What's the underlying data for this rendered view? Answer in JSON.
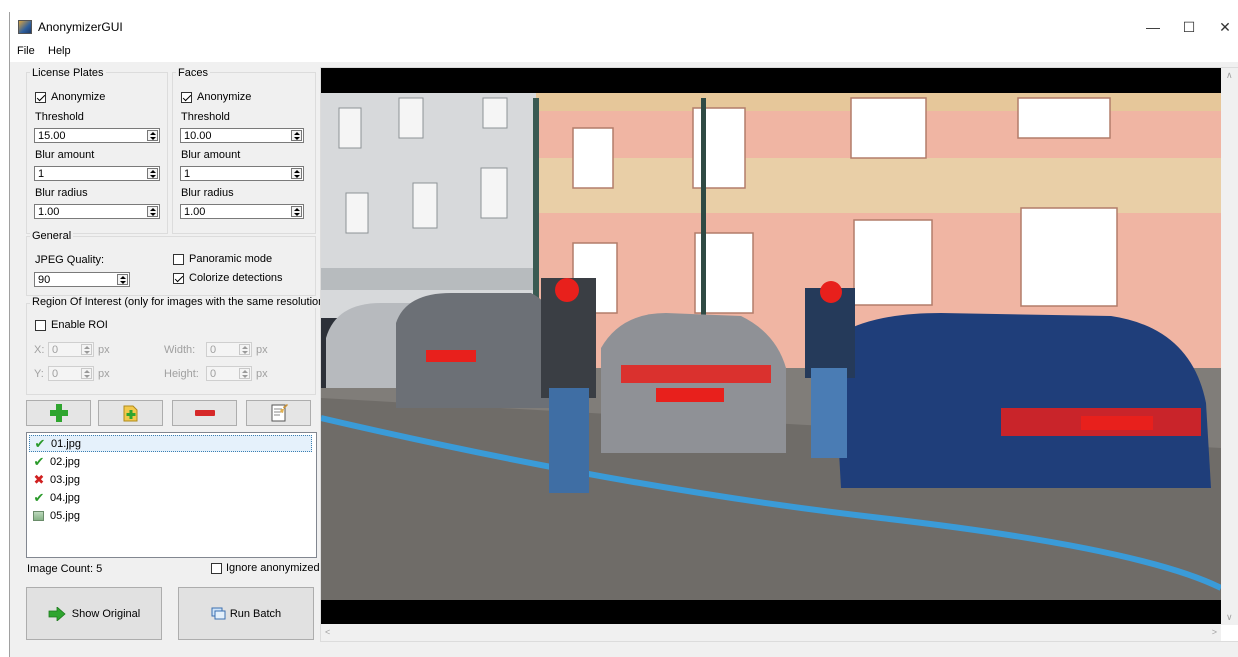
{
  "window": {
    "title": "AnonymizerGUI",
    "controls": {
      "minimize": "—",
      "maximize": "☐",
      "close": "✕"
    }
  },
  "menu": {
    "items": [
      "File",
      "Help"
    ]
  },
  "license_plates": {
    "group_title": "License Plates",
    "anonymize_label": "Anonymize",
    "anonymize_checked": true,
    "threshold_label": "Threshold",
    "threshold_value": "15.00",
    "blur_amount_label": "Blur amount",
    "blur_amount_value": "1",
    "blur_radius_label": "Blur radius",
    "blur_radius_value": "1.00"
  },
  "faces": {
    "group_title": "Faces",
    "anonymize_label": "Anonymize",
    "anonymize_checked": true,
    "threshold_label": "Threshold",
    "threshold_value": "10.00",
    "blur_amount_label": "Blur amount",
    "blur_amount_value": "1",
    "blur_radius_label": "Blur radius",
    "blur_radius_value": "1.00"
  },
  "general": {
    "group_title": "General",
    "jpeg_quality_label": "JPEG Quality:",
    "jpeg_quality_value": "90",
    "panoramic_label": "Panoramic mode",
    "panoramic_checked": false,
    "colorize_label": "Colorize detections",
    "colorize_checked": true
  },
  "roi": {
    "group_title": "Region Of Interest  (only for images with the same resolution!)",
    "enable_label": "Enable ROI",
    "enable_checked": false,
    "x_label": "X:",
    "x_value": "0",
    "y_label": "Y:",
    "y_value": "0",
    "width_label": "Width:",
    "width_value": "0",
    "height_label": "Height:",
    "height_value": "0",
    "unit": "px"
  },
  "toolbar": {
    "add_icon": "plus-icon",
    "add_folder_icon": "add-folder-icon",
    "remove_icon": "minus-icon",
    "clear_icon": "clear-list-icon"
  },
  "files": [
    {
      "name": "01.jpg",
      "status": "done",
      "selected": true
    },
    {
      "name": "02.jpg",
      "status": "done",
      "selected": false
    },
    {
      "name": "03.jpg",
      "status": "error",
      "selected": false
    },
    {
      "name": "04.jpg",
      "status": "done",
      "selected": false
    },
    {
      "name": "05.jpg",
      "status": "pending",
      "selected": false
    }
  ],
  "status": {
    "image_count": "Image Count: 5",
    "ignore_label": "Ignore anonymized",
    "ignore_checked": false
  },
  "actions": {
    "show_original": "Show Original",
    "run_batch": "Run Batch"
  },
  "colors": {
    "detection_red": "#e8201c",
    "accent_green": "#2a9a2a",
    "selection_blue": "#e5f1fb"
  }
}
